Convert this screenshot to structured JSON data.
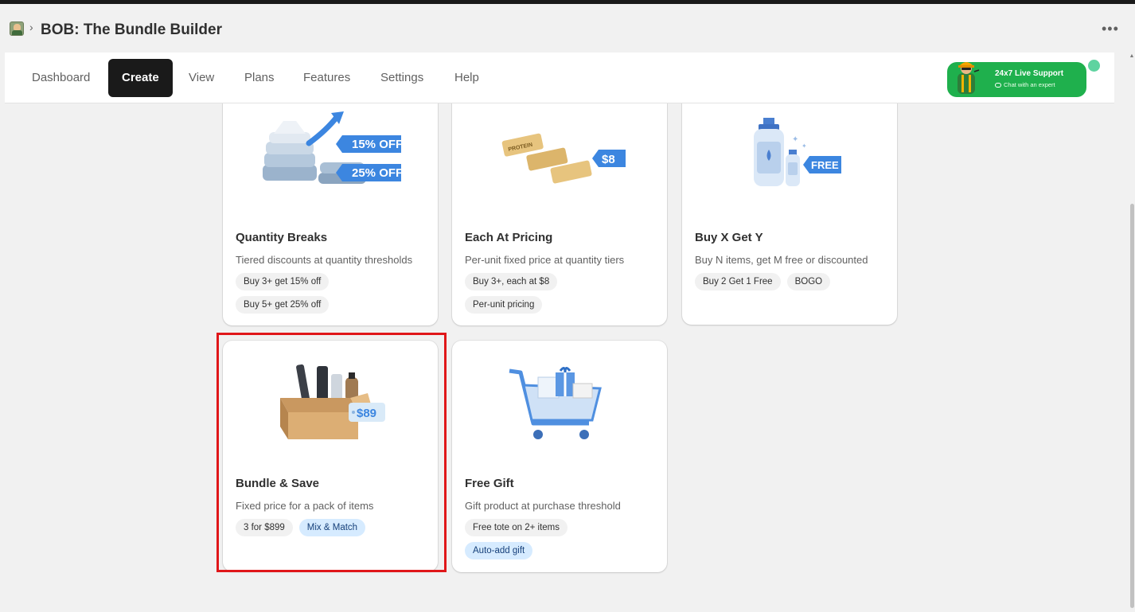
{
  "app": {
    "title": "BOB: The Bundle Builder",
    "breadcrumb_sep": "›",
    "more_label": "•••"
  },
  "nav": {
    "items": [
      {
        "label": "Dashboard",
        "active": false
      },
      {
        "label": "Create",
        "active": true
      },
      {
        "label": "View",
        "active": false
      },
      {
        "label": "Plans",
        "active": false
      },
      {
        "label": "Features",
        "active": false
      },
      {
        "label": "Settings",
        "active": false
      },
      {
        "label": "Help",
        "active": false
      }
    ]
  },
  "support": {
    "title": "24x7 Live Support",
    "subtitle": "Chat with an expert"
  },
  "cards": [
    {
      "title": "Quantity Breaks",
      "description": "Tiered discounts at quantity thresholds",
      "image_labels": [
        "15% OFF",
        "25% OFF"
      ],
      "tags": [
        {
          "label": "Buy 3+ get 15% off"
        },
        {
          "label": "Buy 5+ get 25% off"
        }
      ]
    },
    {
      "title": "Each At Pricing",
      "description": "Per-unit fixed price at quantity tiers",
      "image_labels": [
        "$8",
        "PROTEIN"
      ],
      "tags": [
        {
          "label": "Buy 3+, each at $8"
        },
        {
          "label": "Per-unit pricing"
        }
      ]
    },
    {
      "title": "Buy X Get Y",
      "description": "Buy N items, get M free or discounted",
      "image_labels": [
        "FREE"
      ],
      "tags": [
        {
          "label": "Buy 2 Get 1 Free"
        },
        {
          "label": "BOGO"
        }
      ]
    },
    {
      "title": "Bundle & Save",
      "description": "Fixed price for a pack of items",
      "image_labels": [
        "$89"
      ],
      "tags": [
        {
          "label": "3 for $899"
        },
        {
          "label": "Mix & Match",
          "highlight": true
        }
      ]
    },
    {
      "title": "Free Gift",
      "description": "Gift product at purchase threshold",
      "image_labels": [],
      "tags": [
        {
          "label": "Free tote on 2+ items"
        },
        {
          "label": "Auto-add gift",
          "highlight": true
        }
      ]
    }
  ],
  "colors": {
    "accent": "#1a1a1a",
    "support_green": "#1fb04d",
    "price_tag_blue": "#3c86e0",
    "selection_red": "#e0171a",
    "tag_blue_bg": "#d6ebff"
  }
}
